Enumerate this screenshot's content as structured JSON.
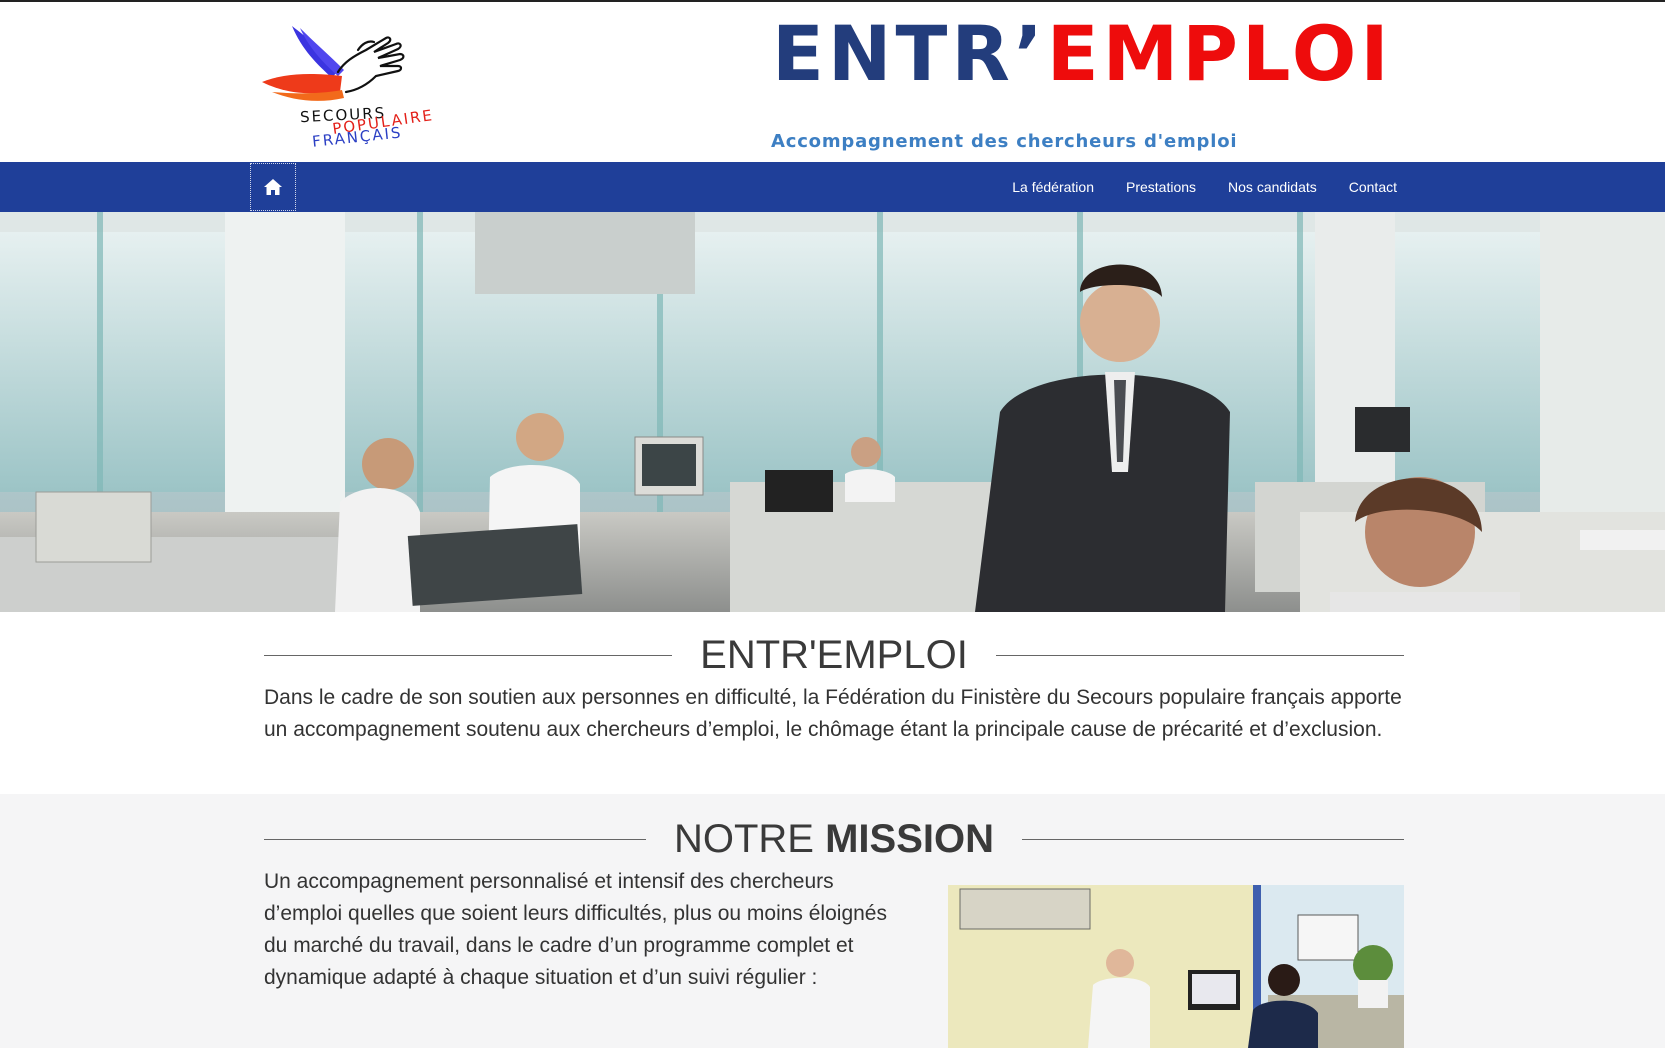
{
  "logo": {
    "line1": "SECOURS",
    "line2": "POPULAIRE",
    "line3": "FRANÇAIS",
    "colors": {
      "blue_wing": "#3b34e0",
      "red_wing": "#ee3a1a",
      "hand_stroke": "#111111"
    }
  },
  "header": {
    "brand_part1": "ENTR’",
    "brand_part2": "EMPLOI",
    "tagline": "Accompagnement des chercheurs d'emploi",
    "colors": {
      "brand_blue": "#233d7c",
      "brand_red": "#ee0c0c",
      "tagline": "#3d7fc3"
    }
  },
  "nav": {
    "home_icon": "home-icon",
    "items": [
      {
        "label": "La fédération"
      },
      {
        "label": "Prestations"
      },
      {
        "label": "Nos candidats"
      },
      {
        "label": "Contact"
      }
    ],
    "background": "#1f3f99"
  },
  "intro": {
    "title": "ENTR'EMPLOI",
    "text": "Dans le cadre de son soutien aux personnes en difficulté, la Fédération du Finistère du Secours populaire français apporte un accompagnement soutenu aux chercheurs d’emploi, le chômage étant la principale cause de précarité et d’exclusion."
  },
  "mission": {
    "title_light": "NOTRE ",
    "title_bold": "MISSION",
    "text": "Un accompagnement personnalisé et intensif des chercheurs d’emploi quelles que soient leurs difficultés, plus ou moins éloignés du marché du travail, dans le cadre d’un programme complet et dynamique adapté à chaque situation et d’un suivi régulier :"
  }
}
